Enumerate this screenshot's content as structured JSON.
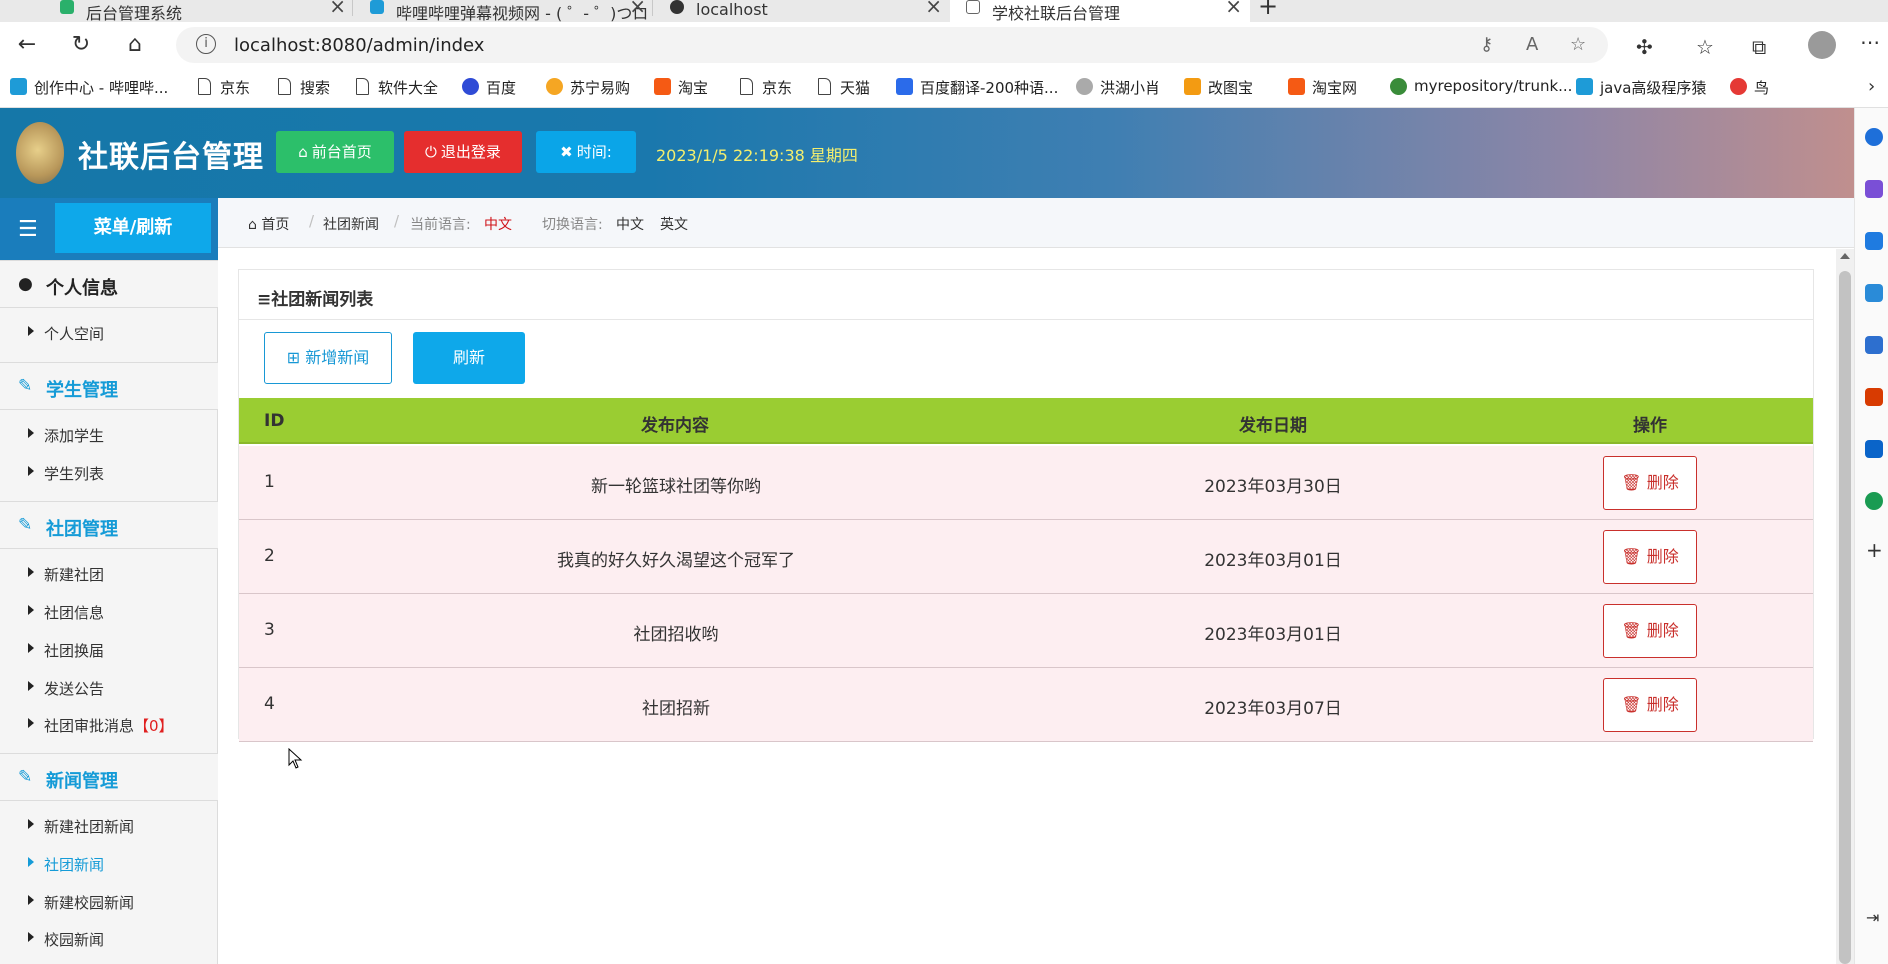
{
  "browser": {
    "tabs": [
      {
        "title": "后台管理系统",
        "color": "#2ab06b"
      },
      {
        "title": "哔哩哔哩弹幕视频网 - ( ゜- ゜)つロ",
        "color": "#1e9bd7"
      },
      {
        "title": "localhost",
        "color": "#333333"
      },
      {
        "title": "学校社联后台管理",
        "color": "#888888"
      }
    ],
    "new_tab": "+",
    "url": "localhost:8080/admin/index",
    "bookmarks": [
      {
        "label": "创作中心 - 哔哩哔...",
        "icon": "bilibili-icon",
        "color": "#1e9bd7"
      },
      {
        "label": "京东",
        "icon": "page-icon",
        "color": ""
      },
      {
        "label": "搜索",
        "icon": "page-icon",
        "color": ""
      },
      {
        "label": "软件大全",
        "icon": "page-icon",
        "color": ""
      },
      {
        "label": "百度",
        "icon": "baidu-icon",
        "color": "#2f4bd6"
      },
      {
        "label": "苏宁易购",
        "icon": "suning-icon",
        "color": "#f5a623"
      },
      {
        "label": "淘宝",
        "icon": "taobao-icon",
        "color": "#f55a14"
      },
      {
        "label": "京东",
        "icon": "page-icon",
        "color": ""
      },
      {
        "label": "天猫",
        "icon": "page-icon",
        "color": ""
      },
      {
        "label": "百度翻译-200种语...",
        "icon": "translate-icon",
        "color": "#2b6bea"
      },
      {
        "label": "洪湖小肖",
        "icon": "bird-icon",
        "color": "#aaaaaa"
      },
      {
        "label": "改图宝",
        "icon": "gaitubao-icon",
        "color": "#f39b12"
      },
      {
        "label": "淘宝网",
        "icon": "taobao-icon",
        "color": "#f55a14"
      },
      {
        "label": "myrepository/trunk...",
        "icon": "chrome-icon",
        "color": "#3a8c3a"
      },
      {
        "label": "java高级程序猿",
        "icon": "bilibili-icon",
        "color": "#1e9bd7"
      },
      {
        "label": "鸟",
        "icon": "bird-red-icon",
        "color": "#e53935"
      }
    ]
  },
  "header": {
    "title": "社联后台管理",
    "btn_home": "前台首页",
    "btn_logout": "退出登录",
    "btn_time": "时间:",
    "clock": "2023/1/5 22:19:38 星期四"
  },
  "sidebar": {
    "menu_refresh": "菜单/刷新",
    "groups": [
      {
        "label": "个人信息",
        "items": [
          {
            "label": "个人空间"
          }
        ]
      },
      {
        "label": "学生管理",
        "items": [
          {
            "label": "添加学生"
          },
          {
            "label": "学生列表"
          }
        ]
      },
      {
        "label": "社团管理",
        "items": [
          {
            "label": "新建社团"
          },
          {
            "label": "社团信息"
          },
          {
            "label": "社团换届"
          },
          {
            "label": "发送公告"
          },
          {
            "label": "社团审批消息",
            "badge": "【0】"
          }
        ]
      },
      {
        "label": "新闻管理",
        "items": [
          {
            "label": "新建社团新闻"
          },
          {
            "label": "社团新闻"
          },
          {
            "label": "新建校园新闻"
          },
          {
            "label": "校园新闻"
          }
        ]
      }
    ]
  },
  "breadcrumb": {
    "home": "首页",
    "current": "社团新闻",
    "lang_label": "当前语言:",
    "lang_value": "中文",
    "switch_label": "切换语言:",
    "lang_zh": "中文",
    "lang_en": "英文"
  },
  "panel": {
    "title": "≡社团新闻列表",
    "btn_add": "⊞ 新增新闻",
    "btn_refresh": "刷新",
    "columns": [
      "ID",
      "发布内容",
      "发布日期",
      "操作"
    ],
    "rows": [
      {
        "id": "1",
        "content": "新一轮篮球社团等你哟",
        "date": "2023年03月30日",
        "action": "删除"
      },
      {
        "id": "2",
        "content": "我真的好久好久渴望这个冠军了",
        "date": "2023年03月01日",
        "action": "删除"
      },
      {
        "id": "3",
        "content": "社团招收哟",
        "date": "2023年03月01日",
        "action": "删除"
      },
      {
        "id": "4",
        "content": "社团招新",
        "date": "2023年03月07日",
        "action": "删除"
      }
    ]
  }
}
